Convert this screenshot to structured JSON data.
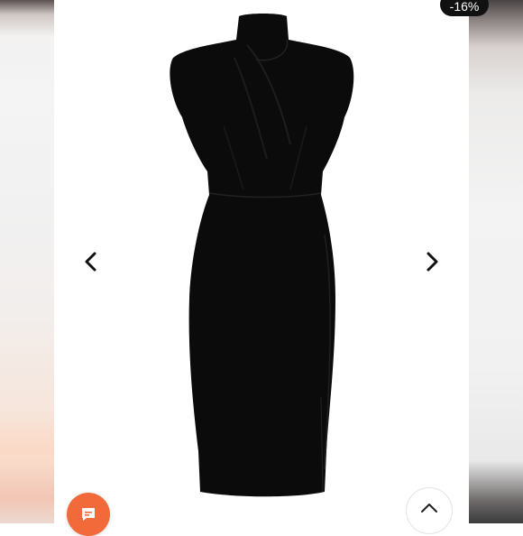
{
  "product": {
    "discount_badge": "-16%"
  },
  "controls": {
    "prev_icon": "chevron-left-icon",
    "next_icon": "chevron-right-icon",
    "chat_icon": "chat-bubble-icon",
    "scroll_top_icon": "chevron-up-icon"
  },
  "colors": {
    "badge_bg": "#111111",
    "chat_button": "#f26a3a",
    "dress": "#0b0b0b"
  }
}
